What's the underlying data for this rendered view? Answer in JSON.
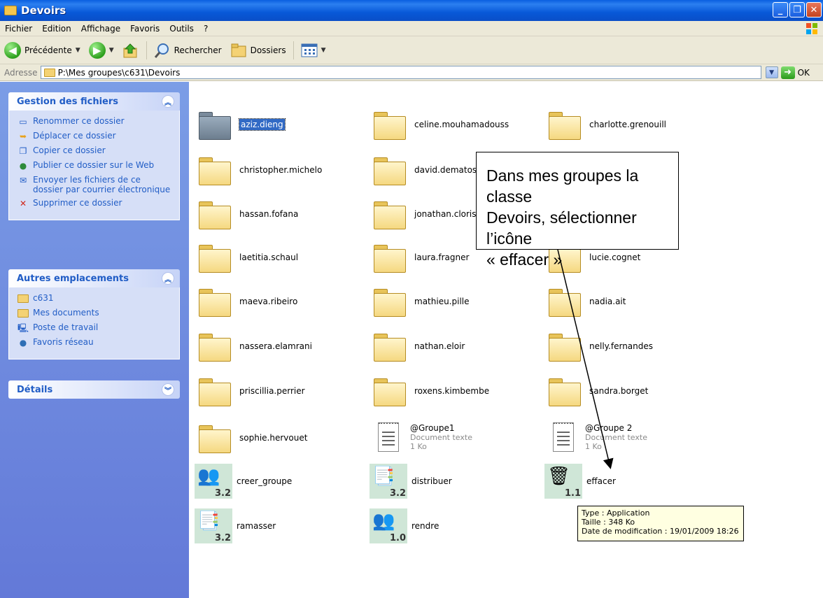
{
  "window": {
    "title": "Devoirs"
  },
  "menu": [
    "Fichier",
    "Edition",
    "Affichage",
    "Favoris",
    "Outils",
    "?"
  ],
  "toolbar": {
    "back_label": "Précédente",
    "search_label": "Rechercher",
    "folders_label": "Dossiers"
  },
  "address": {
    "label": "Adresse",
    "value": "P:\\Mes groupes\\c631\\Devoirs",
    "go_label": "OK"
  },
  "tasks_panel": {
    "title": "Gestion des fichiers",
    "items": [
      "Renommer ce dossier",
      "Déplacer ce dossier",
      "Copier ce dossier",
      "Publier ce dossier sur le Web",
      "Envoyer les fichiers de ce dossier par courrier électronique",
      "Supprimer ce dossier"
    ]
  },
  "places_panel": {
    "title": "Autres emplacements",
    "items": [
      "c631",
      "Mes documents",
      "Poste de travail",
      "Favoris réseau"
    ]
  },
  "details_panel": {
    "title": "Détails"
  },
  "folders": [
    "aziz.dieng",
    "celine.mouhamadouss",
    "charlotte.grenouill",
    "christopher.michelo",
    "david.dematos",
    "hassan.fofana",
    "jonathan.cloris",
    "laetitia.schaul",
    "laura.fragner",
    "lucie.cognet",
    "maeva.ribeiro",
    "mathieu.pille",
    "nadia.ait",
    "nassera.elamrani",
    "nathan.eloir",
    "nelly.fernandes",
    "priscillia.perrier",
    "roxens.kimbembe",
    "sandra.borget",
    "sophie.hervouet"
  ],
  "documents": [
    {
      "name": "@Groupe1",
      "type": "Document texte",
      "size": "1 Ko"
    },
    {
      "name": "@Groupe 2",
      "type": "Document texte",
      "size": "1 Ko"
    }
  ],
  "apps": [
    {
      "name": "creer_groupe",
      "version": "3.2"
    },
    {
      "name": "distribuer",
      "version": "3.2"
    },
    {
      "name": "effacer",
      "version": "1.1"
    },
    {
      "name": "ramasser",
      "version": "3.2"
    },
    {
      "name": "rendre",
      "version": "1.0"
    }
  ],
  "tooltip": {
    "line1": "Type : Application",
    "line2": "Taille : 348 Ko",
    "line3": "Date de modification : 19/01/2009 18:26"
  },
  "callout": {
    "line1": "Dans mes groupes la classe",
    "line2": "Devoirs, sélectionner l’icône",
    "line3": "« effacer »"
  }
}
